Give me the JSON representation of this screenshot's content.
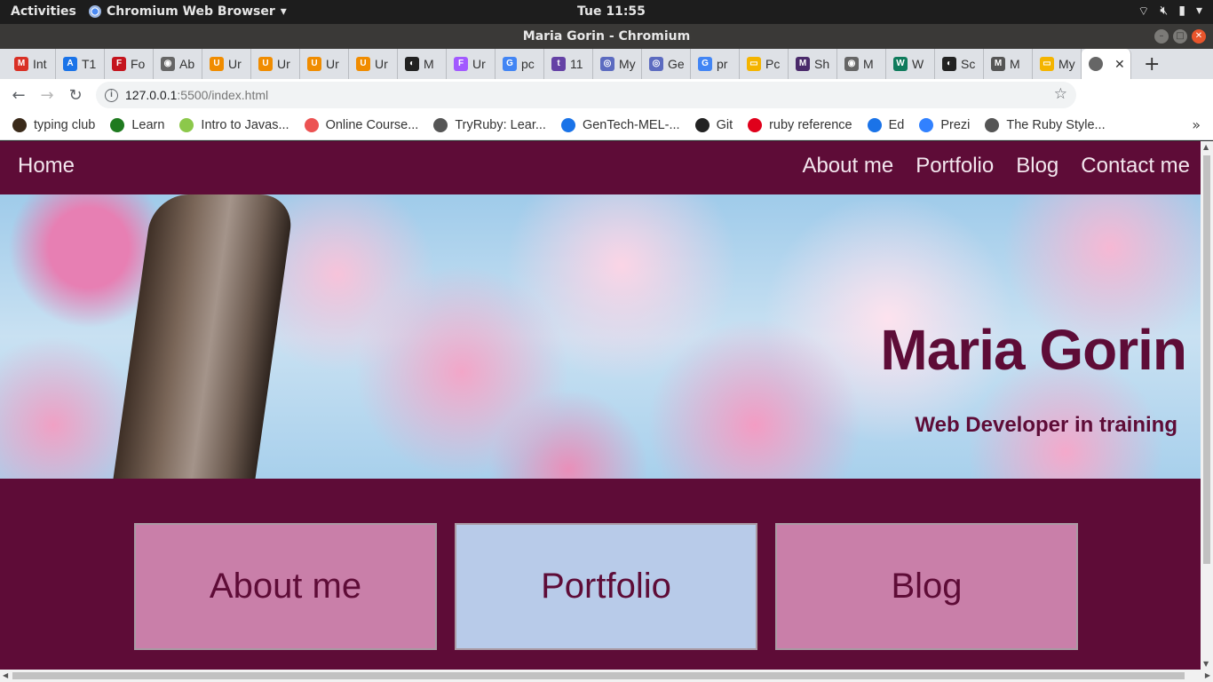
{
  "system": {
    "activities": "Activities",
    "app_name": "Chromium Web Browser",
    "clock": "Tue 11:55"
  },
  "window": {
    "title": "Maria Gorin - Chromium"
  },
  "tabs": [
    {
      "label": "Int",
      "icon": "gmail-icon",
      "color": "#d93025",
      "glyph": "M"
    },
    {
      "label": "T1",
      "icon": "app-icon",
      "color": "#1a73e8",
      "glyph": "A"
    },
    {
      "label": "Fo",
      "icon": "flag-icon",
      "color": "#c4141d",
      "glyph": "F"
    },
    {
      "label": "Ab",
      "icon": "globe-icon",
      "color": "#666666",
      "glyph": "◉"
    },
    {
      "label": "Ur",
      "icon": "udacity-icon",
      "color": "#f08c00",
      "glyph": "U"
    },
    {
      "label": "Ur",
      "icon": "udacity-icon",
      "color": "#f08c00",
      "glyph": "U"
    },
    {
      "label": "Ur",
      "icon": "udacity-icon",
      "color": "#f08c00",
      "glyph": "U"
    },
    {
      "label": "Ur",
      "icon": "udacity-icon",
      "color": "#f08c00",
      "glyph": "U"
    },
    {
      "label": "M",
      "icon": "github-icon",
      "color": "#222222",
      "glyph": "◐"
    },
    {
      "label": "Ur",
      "icon": "figma-icon",
      "color": "#a259ff",
      "glyph": "F"
    },
    {
      "label": "pc",
      "icon": "google-icon",
      "color": "#4285f4",
      "glyph": "G"
    },
    {
      "label": "11",
      "icon": "twitch-icon",
      "color": "#6441a5",
      "glyph": "t"
    },
    {
      "label": "My",
      "icon": "spiral-icon",
      "color": "#5c6bc0",
      "glyph": "◎"
    },
    {
      "label": "Ge",
      "icon": "spiral-icon",
      "color": "#5c6bc0",
      "glyph": "◎"
    },
    {
      "label": "pr",
      "icon": "google-icon",
      "color": "#4285f4",
      "glyph": "G"
    },
    {
      "label": "Pc",
      "icon": "slides-icon",
      "color": "#f4b400",
      "glyph": "▭"
    },
    {
      "label": "Sh",
      "icon": "mask-icon",
      "color": "#4a2a6a",
      "glyph": "M"
    },
    {
      "label": "M",
      "icon": "globe-icon",
      "color": "#666666",
      "glyph": "◉"
    },
    {
      "label": "W",
      "icon": "mail-icon",
      "color": "#0f7b5c",
      "glyph": "W"
    },
    {
      "label": "Sc",
      "icon": "github-icon",
      "color": "#222222",
      "glyph": "◐"
    },
    {
      "label": "M",
      "icon": "markdown-icon",
      "color": "#555555",
      "glyph": "M"
    },
    {
      "label": "My",
      "icon": "slides-icon",
      "color": "#f4b400",
      "glyph": "▭"
    }
  ],
  "active_tab": {
    "icon": "globe-icon",
    "close": "✕"
  },
  "toolbar": {
    "url_host": "127.0.0.1",
    "url_path": ":5500/index.html"
  },
  "bookmarks": [
    {
      "label": "typing club",
      "icon": "typing-club-icon",
      "color": "#3a2a1a"
    },
    {
      "label": "Learn",
      "icon": "learn-icon",
      "color": "#1f7a1f"
    },
    {
      "label": "Intro to Javas...",
      "icon": "node-icon",
      "color": "#8cc84b"
    },
    {
      "label": "Online Course...",
      "icon": "udemy-icon",
      "color": "#ec5252"
    },
    {
      "label": "TryRuby: Lear...",
      "icon": "globe-icon",
      "color": "#555555"
    },
    {
      "label": "GenTech-MEL-...",
      "icon": "app-icon",
      "color": "#1a73e8"
    },
    {
      "label": "Git",
      "icon": "github-icon",
      "color": "#222222"
    },
    {
      "label": "ruby reference",
      "icon": "ruby-icon",
      "color": "#e0001b"
    },
    {
      "label": "Ed",
      "icon": "app-icon",
      "color": "#1a73e8"
    },
    {
      "label": "Prezi",
      "icon": "prezi-icon",
      "color": "#3181ff"
    },
    {
      "label": "The Ruby Style...",
      "icon": "globe-icon",
      "color": "#555555"
    }
  ],
  "site": {
    "nav": {
      "home": "Home",
      "links": [
        "About me",
        "Portfolio",
        "Blog",
        "Contact me"
      ]
    },
    "hero": {
      "title": "Maria Gorin",
      "subtitle": "Web Developer in training"
    },
    "cards": [
      {
        "label": "About me",
        "color": "#c97fa9"
      },
      {
        "label": "Portfolio",
        "color": "#b8cbe9"
      },
      {
        "label": "Blog",
        "color": "#c97fa9"
      }
    ],
    "colors": {
      "primary": "#5e0c37",
      "nav_text": "#f3e6ee"
    }
  }
}
